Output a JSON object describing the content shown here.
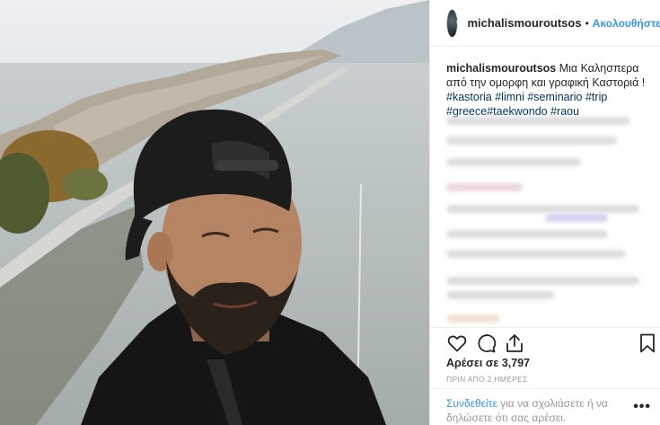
{
  "post": {
    "username": "michalismouroutsos",
    "dot": "•",
    "follow_label": "Ακολουθήστε",
    "caption": {
      "username": "michalismouroutsos",
      "text": "Μια Καλησπερα από την ομορφη και γραφική Καστοριά !",
      "hashtags": [
        "#kastoria",
        "#limni",
        "#seminario",
        "#trip",
        "#greece",
        "#taekwondo",
        "#raou"
      ]
    },
    "likes_label": "Αρέσει σε",
    "likes_count": "3,797",
    "time_ago": "ΠΡΙΝ ΑΠΟ 2 ΗΜΕΡΕΣ",
    "login": {
      "link": "Συνδεθείτε",
      "text": "για να σχολιάσετε ή να δηλώσετε ότι σας αρέσει."
    },
    "more_label": "•••"
  },
  "icons": {
    "like": "heart-icon",
    "comment": "comment-icon",
    "share": "share-icon",
    "save": "bookmark-icon"
  },
  "colors": {
    "link_blue": "#3897f0",
    "hashtag": "#003569",
    "muted": "#999999",
    "text": "#262626"
  }
}
